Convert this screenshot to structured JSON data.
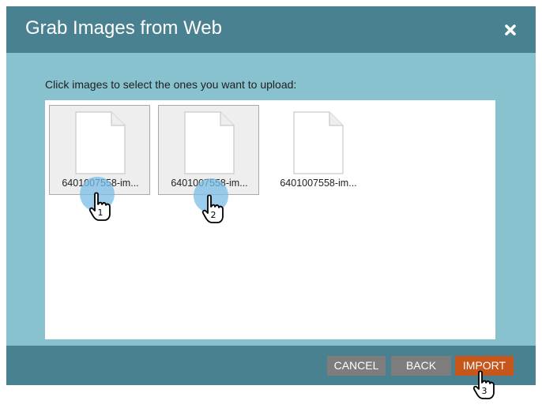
{
  "dialog": {
    "title": "Grab Images from Web",
    "close_icon": "close-icon",
    "instruction": "Click images to select the ones you want to upload:",
    "images": [
      {
        "filename": "6401007558-im...",
        "selected": true,
        "icon": "document-icon"
      },
      {
        "filename": "6401007558-im...",
        "selected": true,
        "icon": "document-icon"
      },
      {
        "filename": "6401007558-im...",
        "selected": false,
        "icon": "document-icon"
      }
    ],
    "buttons": {
      "cancel": "CANCEL",
      "back": "BACK",
      "import": "IMPORT"
    }
  },
  "annotations": {
    "step1": "1",
    "step2": "2",
    "step3": "3",
    "cursor_icon": "hand-pointer-icon"
  },
  "colors": {
    "titlebar": "#4a8190",
    "body": "#88c2cf",
    "import_button": "#c7561b",
    "secondary_button": "#7d7d7d"
  }
}
